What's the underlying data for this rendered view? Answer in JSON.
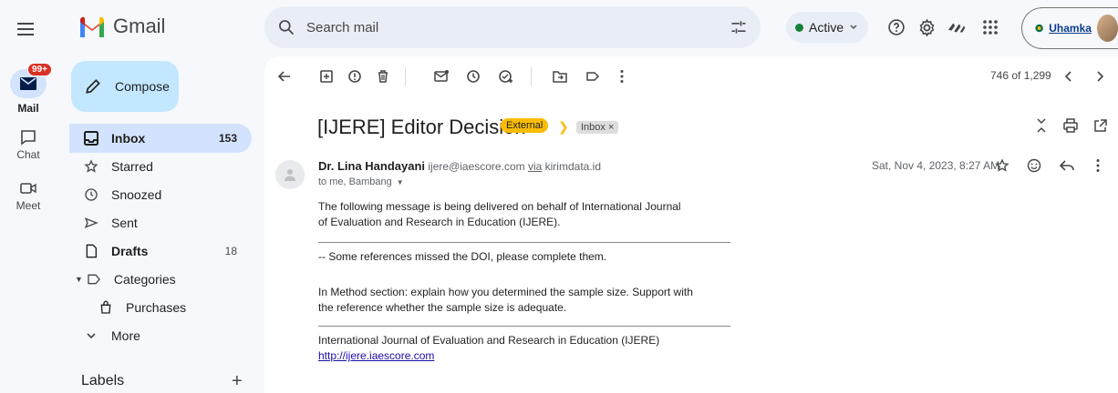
{
  "app": {
    "name": "Gmail"
  },
  "search": {
    "placeholder": "Search mail"
  },
  "status": {
    "label": "Active"
  },
  "account": {
    "org_label": "Uhamka"
  },
  "rail": {
    "mail_label": "Mail",
    "mail_badge": "99+",
    "chat_label": "Chat",
    "meet_label": "Meet"
  },
  "sidebar": {
    "compose_label": "Compose",
    "items": [
      {
        "label": "Inbox",
        "count": "153",
        "icon": "inbox-icon"
      },
      {
        "label": "Starred",
        "count": "",
        "icon": "star-icon"
      },
      {
        "label": "Snoozed",
        "count": "",
        "icon": "clock-icon"
      },
      {
        "label": "Sent",
        "count": "",
        "icon": "send-icon"
      },
      {
        "label": "Drafts",
        "count": "18",
        "icon": "draft-icon"
      },
      {
        "label": "Categories",
        "count": "",
        "icon": "label-icon"
      },
      {
        "label": "Purchases",
        "count": "",
        "icon": "bag-icon"
      },
      {
        "label": "More",
        "count": "",
        "icon": "chevron-down-icon"
      }
    ],
    "labels_title": "Labels"
  },
  "toolbar": {
    "pager": "746 of 1,299"
  },
  "email": {
    "subject": "[IJERE] Editor Decision",
    "chip_external": "External",
    "chip_inbox": "Inbox",
    "sender_name": "Dr. Lina Handayani",
    "sender_email": "ijere@iaescore.com",
    "via_label": "via",
    "via_domain": "kirimdata.id",
    "to_line": "to me, Bambang",
    "date": "Sat, Nov 4, 2023, 8:27 AM",
    "body": {
      "p1_line1": "The following message is being delivered on behalf of International Journal",
      "p1_line2": "of Evaluation and Research in Education (IJERE).",
      "p2": "-- Some references missed the DOI, please complete them.",
      "p3_line1": "In Method section: explain how you determined the sample size. Support with",
      "p3_line2": "the reference whether the sample size is adequate.",
      "footer_name": "International Journal of Evaluation and Research in Education (IJERE)",
      "footer_link": "http://ijere.iaescore.com"
    }
  }
}
